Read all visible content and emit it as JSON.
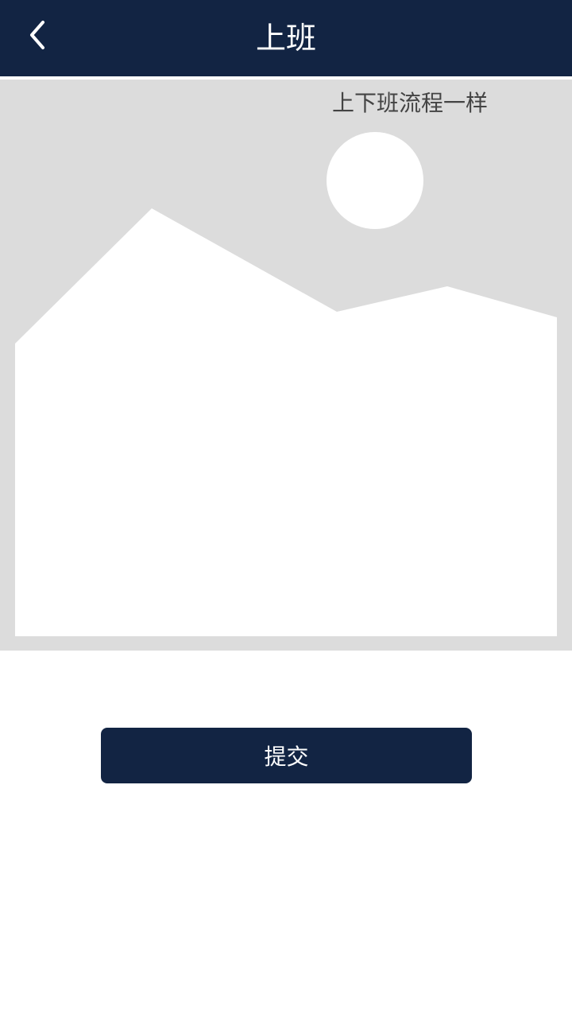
{
  "header": {
    "title": "上班",
    "back_icon": "chevron-left-icon"
  },
  "photo": {
    "note": "上下班流程一样",
    "placeholder_icon": "image-placeholder-icon",
    "background_color": "#dcdcdc"
  },
  "actions": {
    "submit_label": "提交"
  },
  "colors": {
    "primary": "#122443",
    "text_on_primary": "#ffffff"
  }
}
